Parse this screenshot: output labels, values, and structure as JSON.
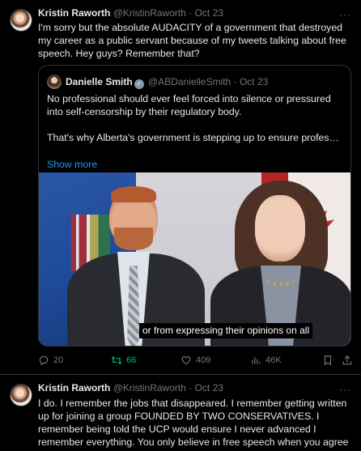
{
  "tweet1": {
    "name": "Kristin Raworth",
    "handle": "@KristinRaworth",
    "separator": "·",
    "date": "Oct 23",
    "more_icon": "more-icon",
    "text": "I'm sorry but the absolute AUDACITY of a government that destroyed my career as a public servant because of my tweets talking about free speech. Hey guys? Remember that?",
    "quote": {
      "name": "Danielle Smith",
      "verified_icon": "verified-badge-icon",
      "handle": "@ABDanielleSmith",
      "separator": "·",
      "date": "Oct 23",
      "paragraph1": "No professional should ever feel forced into silence or pressured into self-censorship by their regulatory body.",
      "paragraph2": "That's why Alberta's government is stepping up to ensure professional regulators stick to what matters: competence, ethics, and public safet...",
      "show_more": "Show more",
      "video_caption": "or from expressing their opinions on all"
    },
    "actions": {
      "reply_count": "20",
      "retweet_count": "66",
      "like_count": "409",
      "views_count": "46K",
      "retweet_color": "#00ba7c"
    }
  },
  "tweet2": {
    "name": "Kristin Raworth",
    "handle": "@KristinRaworth",
    "separator": "·",
    "date": "Oct 23",
    "more_icon": "more-icon",
    "text": "I do. I remember the jobs that disappeared. I remember getting written up for joining a group FOUNDED BY TWO CONSERVATIVES. I remember being told the UCP would ensure I never advanced I remember everything. You only believe in free speech when you agree with it."
  },
  "colors": {
    "background": "#000000",
    "text": "#e7e9ea",
    "muted": "#71767b",
    "link": "#1d9bf0",
    "border": "#2f3336"
  }
}
